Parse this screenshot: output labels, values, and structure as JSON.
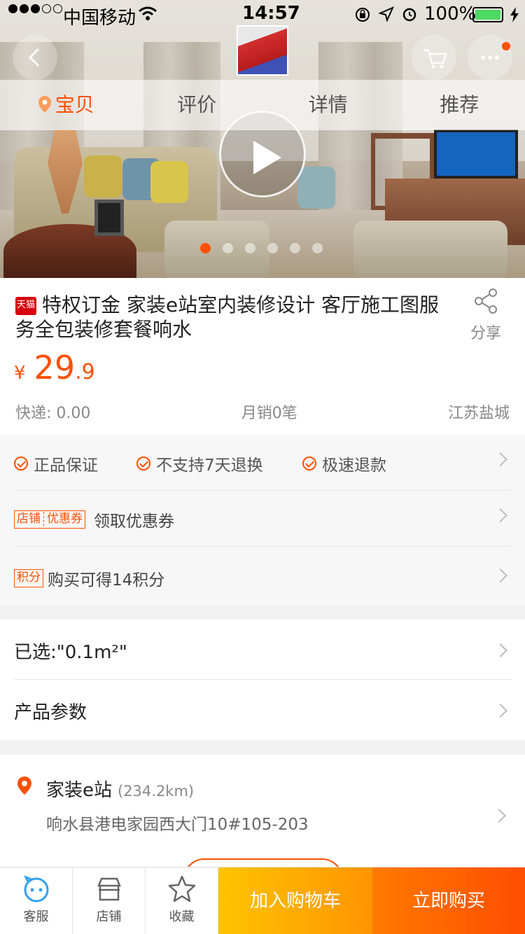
{
  "status_bar": {
    "carrier": "中国移动",
    "time": "14:57",
    "battery_percent": "100%",
    "battery_level": 1.0,
    "signal_filled": 3,
    "signal_total": 5
  },
  "header_tabs": [
    {
      "label": "宝贝",
      "active": true,
      "icon": "location-pin-icon"
    },
    {
      "label": "评价",
      "active": false
    },
    {
      "label": "详情",
      "active": false
    },
    {
      "label": "推荐",
      "active": false
    }
  ],
  "gallery": {
    "has_video": true,
    "current_index": 1,
    "total_slides": 6
  },
  "product": {
    "tag": "天猫",
    "title": "特权订金 家装e站室内装修设计 客厅施工图服务全包装修套餐响水",
    "price_currency": "¥",
    "price_integer": "29",
    "price_decimal": ".9",
    "shipping": "快递: 0.00",
    "monthly_sales": "月销0笔",
    "location": "江苏盐城",
    "share_label": "分享"
  },
  "services": {
    "guarantees": [
      "正品保证",
      "不支持7天退换",
      "极速退款"
    ],
    "coupon_tag_1": "店铺",
    "coupon_tag_2": "优惠券",
    "coupon_text": "领取优惠券",
    "points_tag": "积分",
    "points_text": "购买可得14积分"
  },
  "options": {
    "selected": "已选:\"0.1m²\"",
    "params": "产品参数"
  },
  "store": {
    "name": "家装e站",
    "distance": "(234.2km)",
    "address": "响水县港电家园西大门10#105-203"
  },
  "bottom_bar": {
    "service_label": "客服",
    "shop_label": "店铺",
    "favorite_label": "收藏",
    "add_cart_label": "加入购物车",
    "buy_now_label": "立即购买"
  },
  "colors": {
    "accent": "#ff5000",
    "cart_gradient": [
      "#ffc400",
      "#ff9402"
    ],
    "buy_gradient": [
      "#ff7a00",
      "#ff4e00"
    ],
    "tmall_red": "#d7000f"
  }
}
